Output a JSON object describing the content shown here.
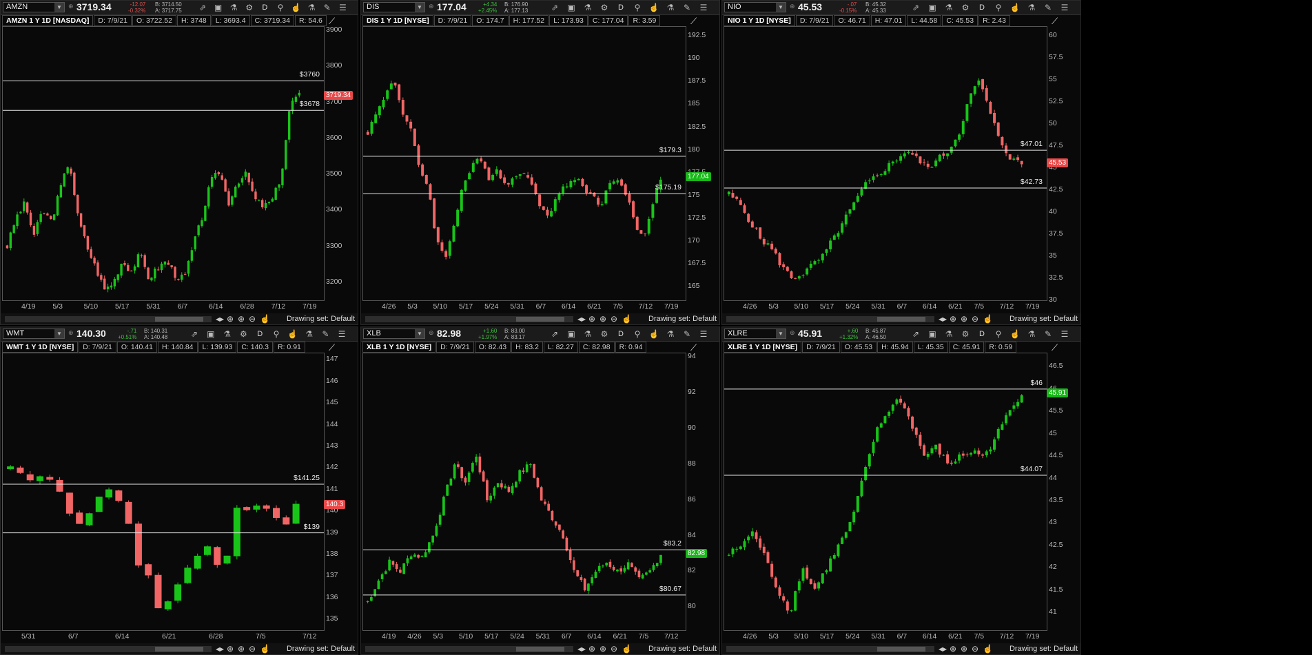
{
  "panels": [
    {
      "symbol": "AMZN",
      "last": "3719.34",
      "chg": "-12.07",
      "pct": "-0.32%",
      "chg_dir": "neg",
      "bid": "B: 3714.50",
      "ask": "A: 3717.75",
      "title": "AMZN 1 Y 1D [NASDAQ]",
      "date": "D: 7/9/21",
      "open": "O: 3722.52",
      "high": "H: 3748",
      "low": "L: 3693.4",
      "close": "C: 3719.34",
      "range": "R: 54.6",
      "ymin": 3150,
      "ymax": 3910,
      "yticks": [
        "3900",
        "3800",
        "3700",
        "3600",
        "3500",
        "3400",
        "3300",
        "3200"
      ],
      "yvals": [
        3900,
        3800,
        3700,
        3600,
        3500,
        3400,
        3300,
        3200
      ],
      "xticks": [
        "4/19",
        "5/3",
        "5/10",
        "5/17",
        "5/31",
        "6/7",
        "6/14",
        "6/28",
        "7/12",
        "7/19"
      ],
      "levels": [
        {
          "v": 3760,
          "label": "$3760"
        },
        {
          "v": 3678,
          "label": "$3678"
        }
      ],
      "price_tag": "3719.34",
      "tag_v": 3719.34,
      "tag_color": "red",
      "bars_count": 88,
      "start": 3300,
      "path": [
        3300,
        3380,
        3420,
        3330,
        3400,
        3370,
        3460,
        3540,
        3380,
        3300,
        3240,
        3180,
        3200,
        3260,
        3230,
        3280,
        3210,
        3240,
        3260,
        3220,
        3210,
        3300,
        3380,
        3480,
        3510,
        3420,
        3480,
        3500,
        3430,
        3410,
        3430,
        3500,
        3700,
        3719
      ],
      "drawing_set": "Drawing set: Default"
    },
    {
      "symbol": "DIS",
      "last": "177.04",
      "chg": "+4.34",
      "pct": "+2.45%",
      "chg_dir": "pos",
      "bid": "B: 176.90",
      "ask": "A: 177.13",
      "title": "DIS 1 Y 1D [NYSE]",
      "date": "D: 7/9/21",
      "open": "O: 174.7",
      "high": "H: 177.52",
      "low": "L: 173.93",
      "close": "C: 177.04",
      "range": "R: 3.59",
      "ymin": 163.5,
      "ymax": 193.5,
      "yticks": [
        "192.5",
        "190",
        "187.5",
        "185",
        "182.5",
        "180",
        "177.5",
        "175",
        "172.5",
        "170",
        "167.5",
        "165"
      ],
      "yvals": [
        192.5,
        190,
        187.5,
        185,
        182.5,
        180,
        177.5,
        175,
        172.5,
        170,
        167.5,
        165
      ],
      "xticks": [
        "4/26",
        "5/3",
        "5/10",
        "5/17",
        "5/24",
        "5/31",
        "6/7",
        "6/14",
        "6/21",
        "7/5",
        "7/12",
        "7/19"
      ],
      "levels": [
        {
          "v": 179.3,
          "label": "$179.3"
        },
        {
          "v": 175.19,
          "label": "$175.19"
        }
      ],
      "price_tag": "177.04",
      "tag_v": 177.04,
      "tag_color": "green",
      "bars_count": 76,
      "start": 182,
      "path": [
        182,
        184,
        186,
        188,
        184,
        182,
        178,
        176,
        170,
        168,
        172,
        176,
        178,
        179,
        177,
        178,
        176,
        177,
        178,
        176,
        174,
        173,
        175,
        176,
        177,
        176,
        175,
        174,
        176,
        177,
        175,
        172,
        170,
        174,
        177
      ],
      "drawing_set": "Drawing set: Default"
    },
    {
      "symbol": "NIO",
      "last": "45.53",
      "chg": "-.07",
      "pct": "-0.15%",
      "chg_dir": "neg",
      "bid": "B: 45.32",
      "ask": "A: 45.33",
      "title": "NIO 1 Y 1D [NYSE]",
      "date": "D: 7/9/21",
      "open": "O: 46.71",
      "high": "H: 47.01",
      "low": "L: 44.58",
      "close": "C: 45.53",
      "range": "R: 2.43",
      "ymin": 30,
      "ymax": 61,
      "yticks": [
        "60",
        "57.5",
        "55",
        "52.5",
        "50",
        "47.5",
        "45",
        "42.5",
        "40",
        "37.5",
        "35",
        "32.5",
        "30"
      ],
      "yvals": [
        60,
        57.5,
        55,
        52.5,
        50,
        47.5,
        45,
        42.5,
        40,
        37.5,
        35,
        32.5,
        30
      ],
      "xticks": [
        "4/26",
        "5/3",
        "5/10",
        "5/17",
        "5/24",
        "5/31",
        "6/7",
        "6/14",
        "6/21",
        "7/5",
        "7/12",
        "7/19"
      ],
      "levels": [
        {
          "v": 47.01,
          "label": "$47.01"
        },
        {
          "v": 42.73,
          "label": "$42.73"
        }
      ],
      "price_tag": "45.53",
      "tag_v": 45.53,
      "tag_color": "red",
      "bars_count": 76,
      "start": 42,
      "path": [
        42,
        41,
        39,
        37,
        36,
        34,
        32.5,
        33,
        34,
        35,
        37,
        39,
        41,
        43,
        44,
        45,
        46,
        47,
        46,
        45,
        46,
        47,
        49,
        53,
        55,
        51,
        48,
        46,
        45.5
      ],
      "drawing_set": "Drawing set: Default"
    },
    {
      "symbol": "WMT",
      "last": "140.30",
      "chg": "-.71",
      "pct": "+0.51%",
      "chg_dir": "pos",
      "bid": "B: 140.31",
      "ask": "A: 140.48",
      "title": "WMT 1 Y 1D [NYSE]",
      "date": "D: 7/9/21",
      "open": "O: 140.41",
      "high": "H: 140.84",
      "low": "L: 139.93",
      "close": "C: 140.3",
      "range": "R: 0.91",
      "ymin": 134.5,
      "ymax": 147.3,
      "yticks": [
        "147",
        "146",
        "145",
        "144",
        "143",
        "142",
        "141",
        "140",
        "139",
        "138",
        "137",
        "136",
        "135"
      ],
      "yvals": [
        147,
        146,
        145,
        144,
        143,
        142,
        141,
        140,
        139,
        138,
        137,
        136,
        135
      ],
      "xticks": [
        "5/31",
        "6/7",
        "6/14",
        "6/21",
        "6/28",
        "7/5",
        "7/12"
      ],
      "levels": [
        {
          "v": 141.25,
          "label": "$141.25"
        },
        {
          "v": 139,
          "label": "$139"
        }
      ],
      "price_tag": "140.3",
      "tag_v": 140.3,
      "tag_color": "red",
      "bars_count": 30,
      "start": 142,
      "path": [
        142,
        141.8,
        141.5,
        141.7,
        141.2,
        140.2,
        139.3,
        140,
        140.8,
        141,
        140.2,
        137.5,
        137,
        135.5,
        136,
        137,
        137.5,
        138.5,
        137.5,
        138,
        140.5,
        140,
        140.3,
        139.8,
        139.3,
        140.3
      ],
      "drawing_set": "Drawing set: Default"
    },
    {
      "symbol": "XLB",
      "last": "82.98",
      "chg": "+1.60",
      "pct": "+1.97%",
      "chg_dir": "pos",
      "bid": "B: 83.00",
      "ask": "A: 83.17",
      "title": "XLB 1 Y 1D [NYSE]",
      "date": "D: 7/9/21",
      "open": "O: 82.43",
      "high": "H: 83.2",
      "low": "L: 82.27",
      "close": "C: 82.98",
      "range": "R: 0.94",
      "ymin": 78.7,
      "ymax": 94.2,
      "yticks": [
        "94",
        "92",
        "90",
        "88",
        "86",
        "84",
        "82",
        "80"
      ],
      "yvals": [
        94,
        92,
        90,
        88,
        86,
        84,
        82,
        80
      ],
      "xticks": [
        "4/19",
        "4/26",
        "5/3",
        "5/10",
        "5/17",
        "5/24",
        "5/31",
        "6/7",
        "6/14",
        "6/21",
        "7/5",
        "7/12"
      ],
      "levels": [
        {
          "v": 83.2,
          "label": "$83.2"
        },
        {
          "v": 80.67,
          "label": "$80.67"
        }
      ],
      "price_tag": "82.98",
      "tag_v": 82.98,
      "tag_color": "green",
      "bars_count": 82,
      "start": 80.3,
      "path": [
        80.3,
        81.5,
        82.5,
        82,
        83,
        82.8,
        84,
        86,
        88,
        87,
        88.5,
        86,
        87,
        86.5,
        87.5,
        88,
        86,
        85,
        84,
        82,
        81,
        82,
        82.5,
        82,
        82.4,
        81.5,
        82,
        82.98
      ],
      "drawing_set": "Drawing set: Default"
    },
    {
      "symbol": "XLRE",
      "last": "45.91",
      "chg": "+.60",
      "pct": "+1.32%",
      "chg_dir": "pos",
      "bid": "B: 45.87",
      "ask": "A: 46.50",
      "title": "XLRE 1 Y 1D [NYSE]",
      "date": "D: 7/9/21",
      "open": "O: 45.53",
      "high": "H: 45.94",
      "low": "L: 45.35",
      "close": "C: 45.91",
      "range": "R: 0.59",
      "ymin": 40.6,
      "ymax": 46.8,
      "yticks": [
        "46.5",
        "46",
        "45.5",
        "45",
        "44.5",
        "44",
        "43.5",
        "43",
        "42.5",
        "42",
        "41.5",
        "41"
      ],
      "yvals": [
        46.5,
        46,
        45.5,
        45,
        44.5,
        44,
        43.5,
        43,
        42.5,
        42,
        41.5,
        41
      ],
      "xticks": [
        "4/26",
        "5/3",
        "5/10",
        "5/17",
        "5/24",
        "5/31",
        "6/7",
        "6/14",
        "6/21",
        "7/5",
        "7/12",
        "7/19"
      ],
      "levels": [
        {
          "v": 46,
          "label": "$46"
        },
        {
          "v": 44.07,
          "label": "$44.07"
        }
      ],
      "price_tag": "45.91",
      "tag_v": 45.91,
      "tag_color": "green",
      "bars_count": 76,
      "start": 42.3,
      "path": [
        42.3,
        42.5,
        42.8,
        42.2,
        41.5,
        41,
        42,
        41.5,
        42,
        42.5,
        43,
        44,
        45,
        45.5,
        45.8,
        45.2,
        44.5,
        44.7,
        44.3,
        44.5,
        44.6,
        44.5,
        45,
        45.5,
        45.91
      ],
      "drawing_set": "Drawing set: Default"
    }
  ],
  "colors": {
    "up": "#19c419",
    "down": "#f26565",
    "line": "#e8e8e8",
    "bg": "#090909"
  },
  "toolbar_icons": [
    "share-icon",
    "calendar-icon",
    "flask-icon",
    "gear-icon",
    "D",
    "style-icon",
    "cursor-icon",
    "flask-icon",
    "draw-icon",
    "menu-icon"
  ]
}
